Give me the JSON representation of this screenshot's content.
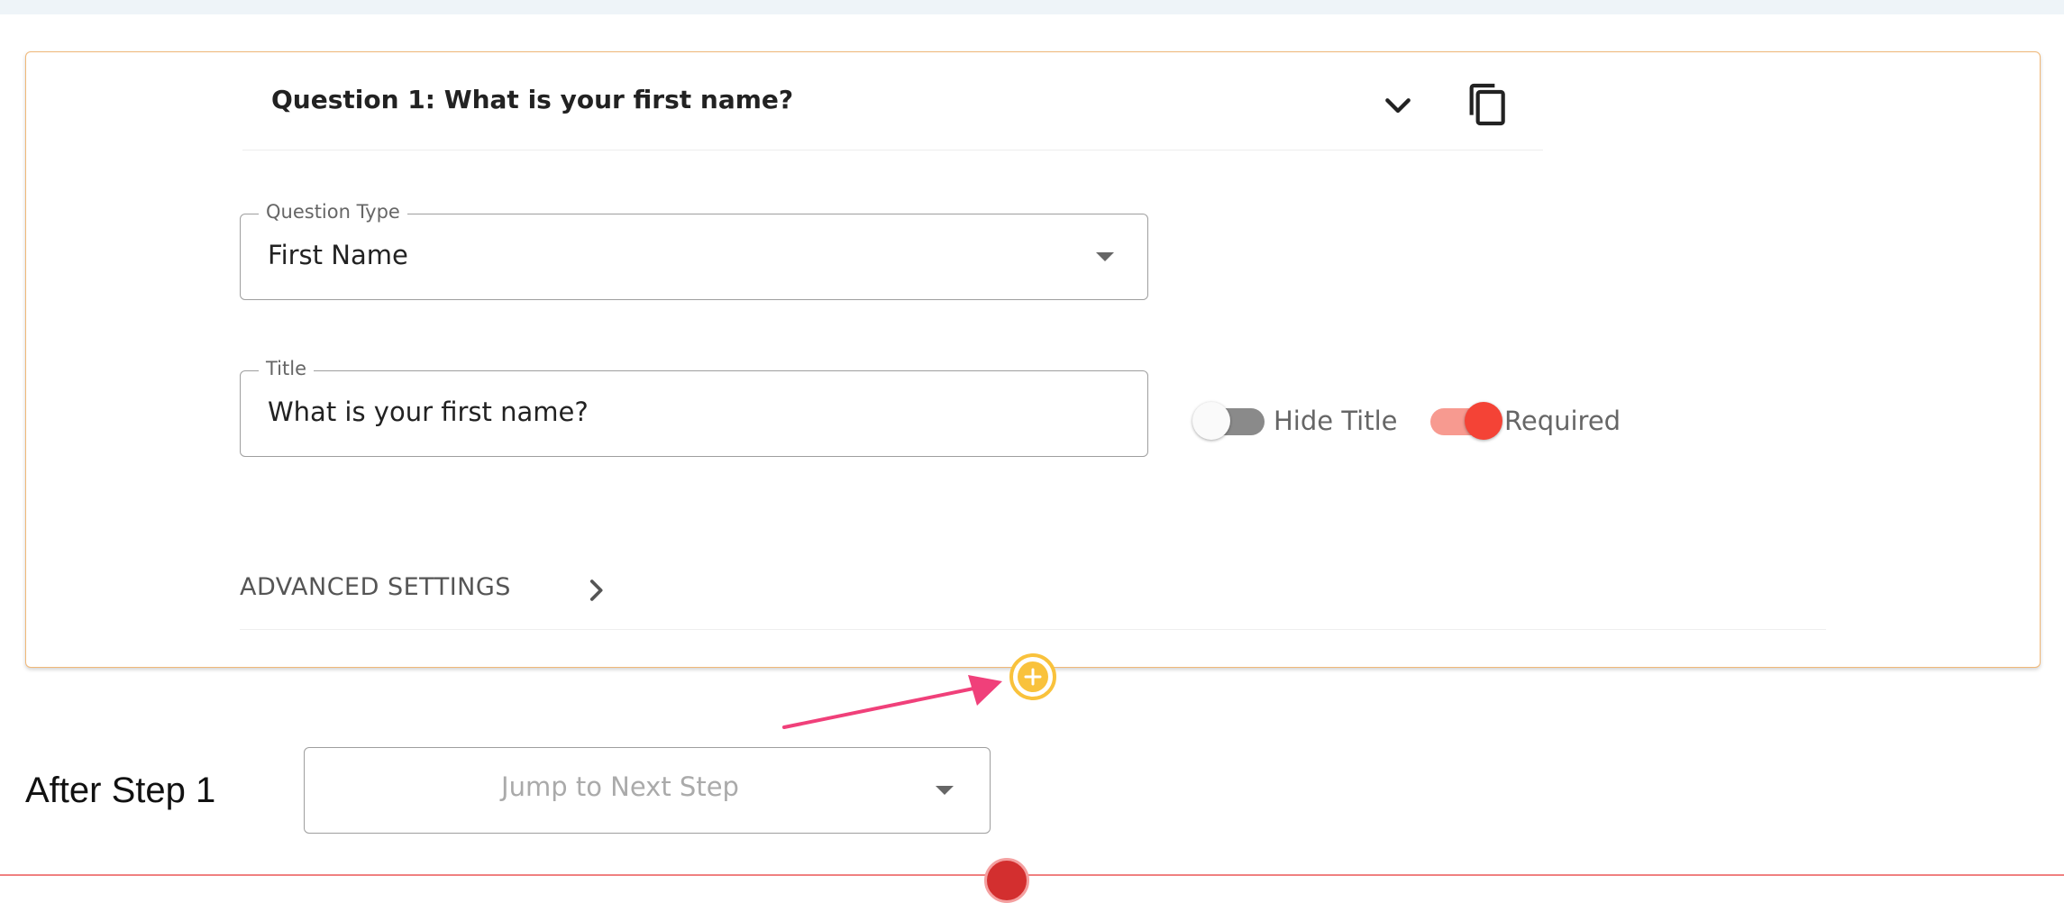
{
  "question": {
    "header_title": "Question 1: What is your first name?",
    "expand_icon": "chevron-down-icon",
    "duplicate_icon": "copy-icon",
    "type_field": {
      "legend": "Question Type",
      "value": "First Name"
    },
    "title_field": {
      "legend": "Title",
      "value": "What is your first name?"
    },
    "toggles": {
      "hide_title": {
        "label": "Hide Title",
        "on": false
      },
      "required": {
        "label": "Required",
        "on": true
      }
    },
    "advanced_settings_label": "ADVANCED SETTINGS"
  },
  "add_question_icon": "plus-circle-icon",
  "after_step": {
    "label": "After Step 1",
    "jump_placeholder": "Jump to Next Step"
  },
  "colors": {
    "card_border": "#f0b878",
    "accent_red": "#f44336",
    "add_button": "#f9c23c",
    "arrow": "#f0407a"
  }
}
